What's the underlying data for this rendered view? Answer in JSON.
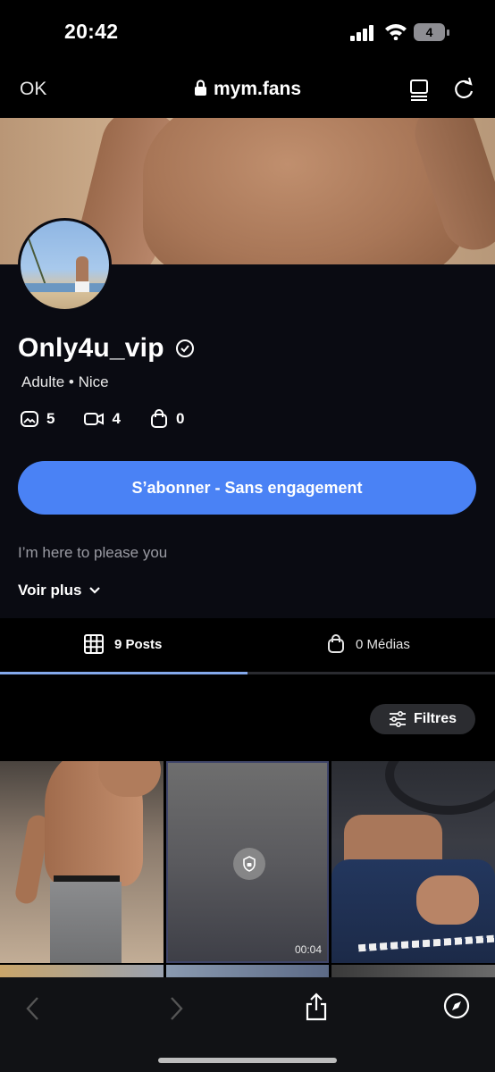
{
  "status_bar": {
    "time": "20:42",
    "battery": "4"
  },
  "browser": {
    "done_label": "OK",
    "url": "mym.fans"
  },
  "profile": {
    "username": "Only4u_vip",
    "meta": "Adulte • Nice",
    "stats": {
      "photos": "5",
      "videos": "4",
      "purchases": "0"
    },
    "subscribe_label": "S’abonner - Sans engagement",
    "bio": "I’m here to please you",
    "see_more_label": "Voir plus"
  },
  "tabs": [
    {
      "label": "9 Posts",
      "icon": "grid-icon",
      "active": true
    },
    {
      "label": "0 Médias",
      "icon": "bag-icon",
      "active": false
    }
  ],
  "filters_label": "Filtres",
  "posts": [
    {
      "locked": false
    },
    {
      "locked": true,
      "duration": "00:04"
    },
    {
      "locked": false
    }
  ],
  "colors": {
    "accent": "#4a82f5",
    "tab_indicator": "#84a9ec",
    "background": "#0a0b12"
  }
}
